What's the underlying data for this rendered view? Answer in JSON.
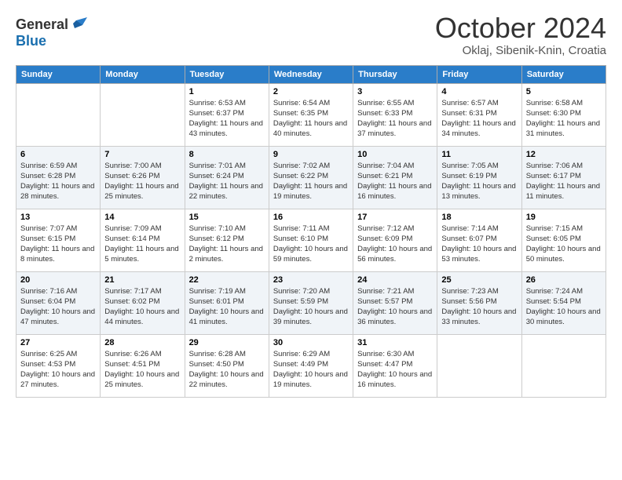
{
  "header": {
    "logo_general": "General",
    "logo_blue": "Blue",
    "month_title": "October 2024",
    "location": "Oklaj, Sibenik-Knin, Croatia"
  },
  "weekdays": [
    "Sunday",
    "Monday",
    "Tuesday",
    "Wednesday",
    "Thursday",
    "Friday",
    "Saturday"
  ],
  "weeks": [
    [
      {
        "day": "",
        "info": ""
      },
      {
        "day": "",
        "info": ""
      },
      {
        "day": "1",
        "info": "Sunrise: 6:53 AM\nSunset: 6:37 PM\nDaylight: 11 hours and 43 minutes."
      },
      {
        "day": "2",
        "info": "Sunrise: 6:54 AM\nSunset: 6:35 PM\nDaylight: 11 hours and 40 minutes."
      },
      {
        "day": "3",
        "info": "Sunrise: 6:55 AM\nSunset: 6:33 PM\nDaylight: 11 hours and 37 minutes."
      },
      {
        "day": "4",
        "info": "Sunrise: 6:57 AM\nSunset: 6:31 PM\nDaylight: 11 hours and 34 minutes."
      },
      {
        "day": "5",
        "info": "Sunrise: 6:58 AM\nSunset: 6:30 PM\nDaylight: 11 hours and 31 minutes."
      }
    ],
    [
      {
        "day": "6",
        "info": "Sunrise: 6:59 AM\nSunset: 6:28 PM\nDaylight: 11 hours and 28 minutes."
      },
      {
        "day": "7",
        "info": "Sunrise: 7:00 AM\nSunset: 6:26 PM\nDaylight: 11 hours and 25 minutes."
      },
      {
        "day": "8",
        "info": "Sunrise: 7:01 AM\nSunset: 6:24 PM\nDaylight: 11 hours and 22 minutes."
      },
      {
        "day": "9",
        "info": "Sunrise: 7:02 AM\nSunset: 6:22 PM\nDaylight: 11 hours and 19 minutes."
      },
      {
        "day": "10",
        "info": "Sunrise: 7:04 AM\nSunset: 6:21 PM\nDaylight: 11 hours and 16 minutes."
      },
      {
        "day": "11",
        "info": "Sunrise: 7:05 AM\nSunset: 6:19 PM\nDaylight: 11 hours and 13 minutes."
      },
      {
        "day": "12",
        "info": "Sunrise: 7:06 AM\nSunset: 6:17 PM\nDaylight: 11 hours and 11 minutes."
      }
    ],
    [
      {
        "day": "13",
        "info": "Sunrise: 7:07 AM\nSunset: 6:15 PM\nDaylight: 11 hours and 8 minutes."
      },
      {
        "day": "14",
        "info": "Sunrise: 7:09 AM\nSunset: 6:14 PM\nDaylight: 11 hours and 5 minutes."
      },
      {
        "day": "15",
        "info": "Sunrise: 7:10 AM\nSunset: 6:12 PM\nDaylight: 11 hours and 2 minutes."
      },
      {
        "day": "16",
        "info": "Sunrise: 7:11 AM\nSunset: 6:10 PM\nDaylight: 10 hours and 59 minutes."
      },
      {
        "day": "17",
        "info": "Sunrise: 7:12 AM\nSunset: 6:09 PM\nDaylight: 10 hours and 56 minutes."
      },
      {
        "day": "18",
        "info": "Sunrise: 7:14 AM\nSunset: 6:07 PM\nDaylight: 10 hours and 53 minutes."
      },
      {
        "day": "19",
        "info": "Sunrise: 7:15 AM\nSunset: 6:05 PM\nDaylight: 10 hours and 50 minutes."
      }
    ],
    [
      {
        "day": "20",
        "info": "Sunrise: 7:16 AM\nSunset: 6:04 PM\nDaylight: 10 hours and 47 minutes."
      },
      {
        "day": "21",
        "info": "Sunrise: 7:17 AM\nSunset: 6:02 PM\nDaylight: 10 hours and 44 minutes."
      },
      {
        "day": "22",
        "info": "Sunrise: 7:19 AM\nSunset: 6:01 PM\nDaylight: 10 hours and 41 minutes."
      },
      {
        "day": "23",
        "info": "Sunrise: 7:20 AM\nSunset: 5:59 PM\nDaylight: 10 hours and 39 minutes."
      },
      {
        "day": "24",
        "info": "Sunrise: 7:21 AM\nSunset: 5:57 PM\nDaylight: 10 hours and 36 minutes."
      },
      {
        "day": "25",
        "info": "Sunrise: 7:23 AM\nSunset: 5:56 PM\nDaylight: 10 hours and 33 minutes."
      },
      {
        "day": "26",
        "info": "Sunrise: 7:24 AM\nSunset: 5:54 PM\nDaylight: 10 hours and 30 minutes."
      }
    ],
    [
      {
        "day": "27",
        "info": "Sunrise: 6:25 AM\nSunset: 4:53 PM\nDaylight: 10 hours and 27 minutes."
      },
      {
        "day": "28",
        "info": "Sunrise: 6:26 AM\nSunset: 4:51 PM\nDaylight: 10 hours and 25 minutes."
      },
      {
        "day": "29",
        "info": "Sunrise: 6:28 AM\nSunset: 4:50 PM\nDaylight: 10 hours and 22 minutes."
      },
      {
        "day": "30",
        "info": "Sunrise: 6:29 AM\nSunset: 4:49 PM\nDaylight: 10 hours and 19 minutes."
      },
      {
        "day": "31",
        "info": "Sunrise: 6:30 AM\nSunset: 4:47 PM\nDaylight: 10 hours and 16 minutes."
      },
      {
        "day": "",
        "info": ""
      },
      {
        "day": "",
        "info": ""
      }
    ]
  ]
}
